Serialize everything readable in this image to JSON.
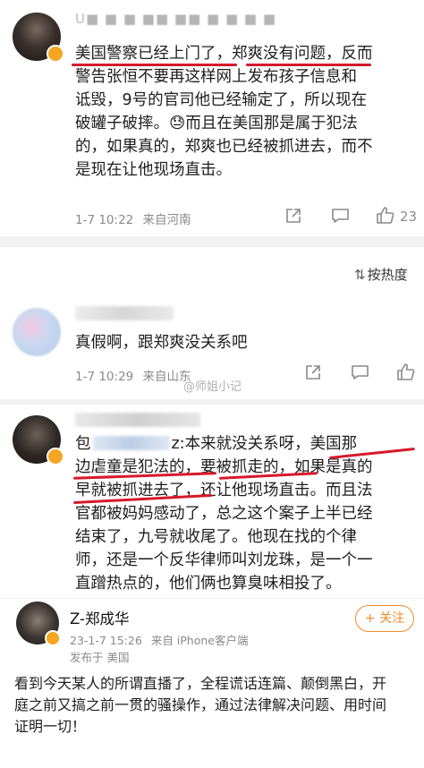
{
  "comment1": {
    "username": "U■ ■ ■ ■■ ■■ ■ ■ ■ ■",
    "text_line1": "美国警察已经上门了，郑爽没有问题，反而",
    "text_line2": "警告张恒不要再这样网上发布孩子信息和",
    "text_line3": "诋毁，9号的官司他已经输定了，所以现在",
    "text_line4": "破罐子破摔。😓而且在美国那是属于犯法",
    "text_line5": "的，如果真的，郑爽也已经被抓进去，而不",
    "text_line6": "是现在让他现场直击。",
    "time": "1-7 10:22",
    "location": "来自河南",
    "likes": "23"
  },
  "sort": {
    "label": "按热度"
  },
  "comment2": {
    "text": "真假啊，跟郑爽没关系吧",
    "time": "1-7 10:29",
    "location": "来自山东"
  },
  "watermark": "@师姐小记",
  "comment3": {
    "text_line1_prefix": "包",
    "text_line1": "z:本来就没关系呀，美国那",
    "text_line2": "边虐童是犯法的，要被抓走的，如果是真的",
    "text_line3": "早就被抓进去了，还让他现场直击。而且法",
    "text_line4": "官都被妈妈感动了，总之这个案子上半已经",
    "text_line5": "结束了，九号就收尾了。他现在找的个律",
    "text_line6": "师，还是一个反华律师叫刘龙珠，是一个一",
    "text_line7": "直蹭热点的，他们俩也算臭味相投了。"
  },
  "post": {
    "author": "Z-郑成华",
    "follow_label": "+ 关注",
    "time": "23-1-7 15:26",
    "source": "来自 iPhone客户端",
    "published_in": "发布于 美国",
    "text_line1": "看到今天某人的所谓直播了，全程谎话连篇、颠倒黑白，开",
    "text_line2": "庭之前又搞之前一贯的骚操作，通过法律解决问题、用时间",
    "text_line3": "证明一切！"
  },
  "colors": {
    "underline": "#d6192b",
    "follow": "#f18b2b",
    "verified": "#f5a623"
  }
}
